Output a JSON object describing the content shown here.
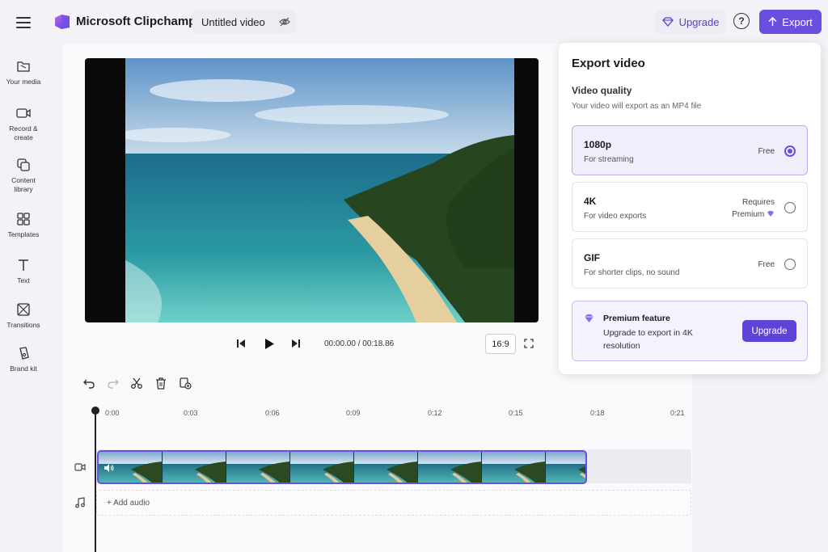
{
  "app": {
    "name": "Microsoft Clipchamp",
    "project_title": "Untitled video",
    "upgrade_label": "Upgrade",
    "help_label": "?",
    "export_label": "Export",
    "accent_color": "#6a4ee0"
  },
  "sidebar": {
    "items": [
      {
        "label": "Your media",
        "icon": "folder-icon"
      },
      {
        "label": "Record &\ncreate",
        "icon": "camera-icon"
      },
      {
        "label": "Content\nlibrary",
        "icon": "library-icon"
      },
      {
        "label": "Templates",
        "icon": "templates-icon"
      },
      {
        "label": "Text",
        "icon": "text-icon"
      },
      {
        "label": "Transitions",
        "icon": "transitions-icon"
      },
      {
        "label": "Brand kit",
        "icon": "brand-kit-icon"
      }
    ]
  },
  "player": {
    "current_time": "00:00.00",
    "total_time": "00:18.86",
    "timecode": "00:00.00 / 00:18.86",
    "aspect_ratio": "16:9"
  },
  "timeline": {
    "ruler": [
      "0:00",
      "0:03",
      "0:06",
      "0:09",
      "0:12",
      "0:15",
      "0:18",
      "0:21"
    ],
    "add_audio_label": "+ Add audio"
  },
  "export_panel": {
    "title": "Export video",
    "quality_heading": "Video quality",
    "quality_subtext": "Your video will export as an MP4 file",
    "options": [
      {
        "name": "1080p",
        "description": "For streaming",
        "tag": "Free",
        "selected": true
      },
      {
        "name": "4K",
        "description": "For video exports",
        "tag_line1": "Requires",
        "tag_line2": "Premium",
        "selected": false
      },
      {
        "name": "GIF",
        "description": "For shorter clips, no sound",
        "tag": "Free",
        "selected": false
      }
    ],
    "premium": {
      "heading": "Premium feature",
      "text": "Upgrade to export in 4K resolution",
      "button": "Upgrade"
    }
  }
}
